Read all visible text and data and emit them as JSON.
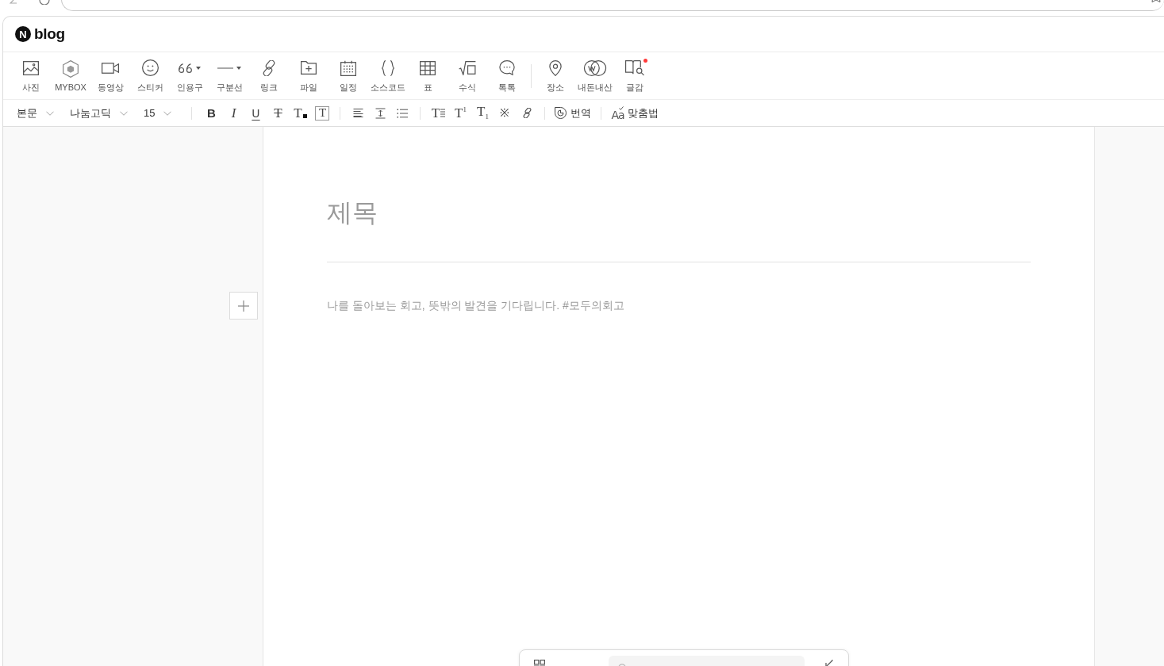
{
  "logo": {
    "mark": "N",
    "text": "blog"
  },
  "insert_toolbar": {
    "groups": [
      [
        {
          "kind": "photo",
          "label": "사진",
          "dropdown": false,
          "dot": false
        },
        {
          "kind": "mybox",
          "label": "MYBOX",
          "dropdown": false,
          "dot": false
        },
        {
          "kind": "video",
          "label": "동영상",
          "dropdown": false,
          "dot": false
        },
        {
          "kind": "sticker",
          "label": "스티커",
          "dropdown": false,
          "dot": false
        },
        {
          "kind": "quote",
          "label": "인용구",
          "dropdown": true,
          "dot": false
        },
        {
          "kind": "divider",
          "label": "구분선",
          "dropdown": true,
          "dot": false
        },
        {
          "kind": "link",
          "label": "링크",
          "dropdown": false,
          "dot": false
        },
        {
          "kind": "file",
          "label": "파일",
          "dropdown": false,
          "dot": false
        },
        {
          "kind": "schedule",
          "label": "일정",
          "dropdown": false,
          "dot": false
        },
        {
          "kind": "code",
          "label": "소스코드",
          "dropdown": false,
          "dot": false
        },
        {
          "kind": "table",
          "label": "표",
          "dropdown": false,
          "dot": false
        },
        {
          "kind": "formula",
          "label": "수식",
          "dropdown": false,
          "dot": false
        },
        {
          "kind": "talk",
          "label": "톡톡",
          "dropdown": false,
          "dot": false
        }
      ],
      [
        {
          "kind": "place",
          "label": "장소",
          "dropdown": false,
          "dot": false
        },
        {
          "kind": "review",
          "label": "내돈내산",
          "dropdown": false,
          "dot": false
        },
        {
          "kind": "material",
          "label": "글감",
          "dropdown": false,
          "dot": true
        }
      ]
    ]
  },
  "format_toolbar": {
    "selects": [
      {
        "value": "본문"
      },
      {
        "value": "나눔고딕"
      },
      {
        "value": "15"
      }
    ],
    "groups": [
      [
        {
          "kind": "bold",
          "glyph": "B"
        },
        {
          "kind": "italic",
          "glyph": "I"
        },
        {
          "kind": "underline",
          "glyph": "U"
        },
        {
          "kind": "strike",
          "glyph": "T"
        },
        {
          "kind": "color",
          "glyph": "T"
        },
        {
          "kind": "background",
          "glyph": "T"
        }
      ],
      [
        {
          "kind": "align"
        },
        {
          "kind": "line-height"
        },
        {
          "kind": "list"
        }
      ],
      [
        {
          "kind": "text-lines",
          "glyph": "T"
        },
        {
          "kind": "superscript",
          "glyph": "T$^{1}$"
        },
        {
          "kind": "subscript",
          "glyph": "T$_{1}$"
        },
        {
          "kind": "special",
          "glyph": "※"
        },
        {
          "kind": "link"
        }
      ],
      [
        {
          "kind": "translate",
          "label": "번역"
        }
      ],
      [
        {
          "kind": "spellcheck",
          "glyph": "Aa",
          "label": "맞춤법"
        }
      ]
    ]
  },
  "editor": {
    "title": {
      "placeholder": "제목"
    },
    "body": {
      "placeholder": "나를 돌아보는 회고, 뜻밖의 발견을 기다립니다. #모두의회고"
    }
  }
}
